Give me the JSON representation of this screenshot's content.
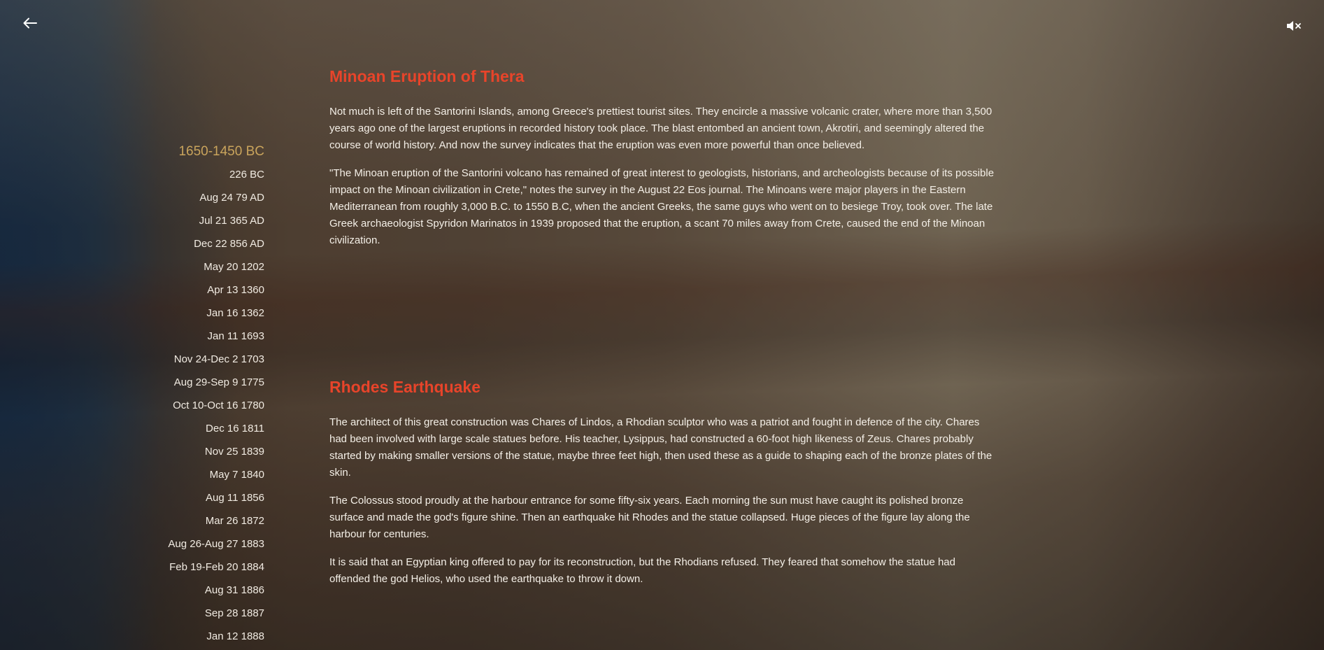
{
  "nav": {
    "back_icon": "arrow-left-icon",
    "mute_icon": "speaker-muted-icon"
  },
  "timeline": {
    "items": [
      {
        "label": "1650-1450 BC",
        "active": true
      },
      {
        "label": "226 BC"
      },
      {
        "label": "Aug 24 79 AD"
      },
      {
        "label": "Jul 21 365 AD"
      },
      {
        "label": "Dec 22 856 AD"
      },
      {
        "label": "May 20 1202"
      },
      {
        "label": "Apr 13 1360"
      },
      {
        "label": "Jan 16 1362"
      },
      {
        "label": "Jan 11 1693"
      },
      {
        "label": "Nov 24-Dec 2 1703"
      },
      {
        "label": "Aug 29-Sep 9 1775"
      },
      {
        "label": "Oct 10-Oct 16 1780"
      },
      {
        "label": "Dec 16 1811"
      },
      {
        "label": "Nov 25 1839"
      },
      {
        "label": "May 7 1840"
      },
      {
        "label": "Aug 11 1856"
      },
      {
        "label": "Mar 26 1872"
      },
      {
        "label": "Aug 26-Aug 27 1883"
      },
      {
        "label": "Feb 19-Feb 20 1884"
      },
      {
        "label": "Aug 31 1886"
      },
      {
        "label": "Sep 28 1887"
      },
      {
        "label": "Jan 12 1888"
      }
    ]
  },
  "sections": [
    {
      "title": "Minoan Eruption of Thera",
      "paragraphs": [
        "Not much is left of the Santorini Islands, among Greece's prettiest tourist sites. They encircle a massive volcanic crater, where more than 3,500 years ago one of the largest eruptions in recorded history took place. The blast entombed an ancient town, Akrotiri, and seemingly altered the course of world history. And now the survey indicates that the eruption was even more powerful than once believed.",
        "\"The Minoan eruption of the Santorini volcano has remained of great interest to geologists, historians, and archeologists because of its possible impact on the Minoan civilization in Crete,\" notes the survey in the August 22 Eos journal. The Minoans were major players in the Eastern Mediterranean from roughly 3,000 B.C. to 1550 B.C, when the ancient Greeks, the same guys who went on to besiege Troy, took over. The late Greek archaeologist Spyridon Marinatos in 1939 proposed that the eruption, a scant 70 miles away from Crete, caused the end of the Minoan civilization."
      ]
    },
    {
      "title": "Rhodes Earthquake",
      "paragraphs": [
        "The architect of this great construction was Chares of Lindos, a Rhodian sculptor who was a patriot and fought in defence of the city. Chares had been involved with large scale statues before. His teacher, Lysippus, had constructed a 60-foot high likeness of Zeus. Chares probably started by making smaller versions of the statue, maybe three feet high, then used these as a guide to shaping each of the bronze plates of the skin.",
        "The Colossus stood proudly at the harbour entrance for some fifty-six years. Each morning the sun must have caught its polished bronze surface and made the god's figure shine. Then an earthquake hit Rhodes and the statue collapsed. Huge pieces of the figure lay along the harbour for centuries.",
        "It is said that an Egyptian king offered to pay for its reconstruction, but the Rhodians refused. They feared that somehow the statue had offended the god Helios, who used the earthquake to throw it down."
      ]
    }
  ],
  "colors": {
    "title": "#e8442a",
    "active_timeline": "#c9a45c",
    "text": "#f4efe7"
  }
}
